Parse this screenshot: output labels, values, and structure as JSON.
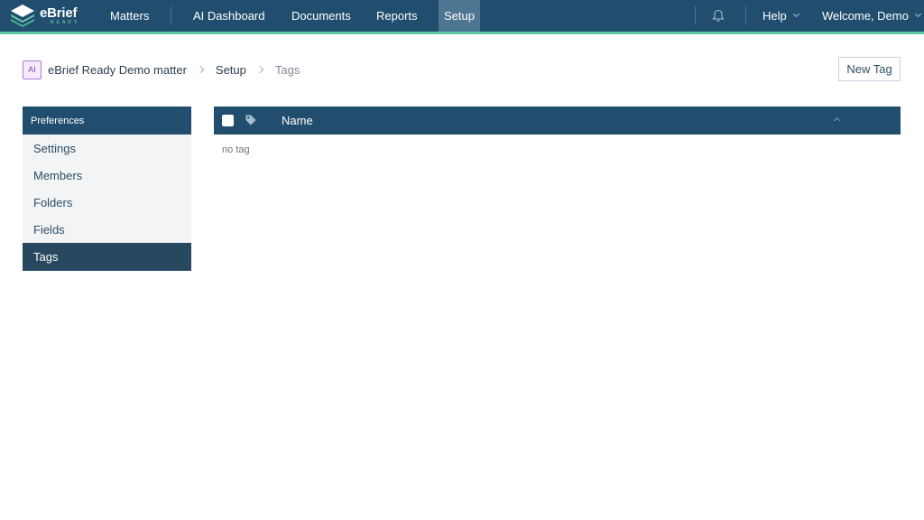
{
  "app": {
    "logo_main": "eBrief",
    "logo_sub": "READY"
  },
  "nav": {
    "matters": "Matters",
    "ai_dashboard": "AI Dashboard",
    "documents": "Documents",
    "reports": "Reports",
    "setup": "Setup",
    "notification_icon": "bell-icon",
    "help": "Help",
    "welcome": "Welcome, Demo"
  },
  "breadcrumb": {
    "badge": "AI",
    "matter": "eBrief Ready Demo matter",
    "setup": "Setup",
    "current": "Tags"
  },
  "actions": {
    "new_tag": "New Tag"
  },
  "sidebar": {
    "header": "Preferences",
    "items": [
      {
        "label": "Settings"
      },
      {
        "label": "Members"
      },
      {
        "label": "Folders"
      },
      {
        "label": "Fields"
      },
      {
        "label": "Tags"
      }
    ]
  },
  "table": {
    "columns": {
      "name": "Name"
    },
    "empty_text": "no tag"
  },
  "colors": {
    "nav_bg": "#214e6e",
    "accent": "#5cc9a7",
    "active_nav": "#4e7591",
    "sidebar_active": "#27485f"
  }
}
